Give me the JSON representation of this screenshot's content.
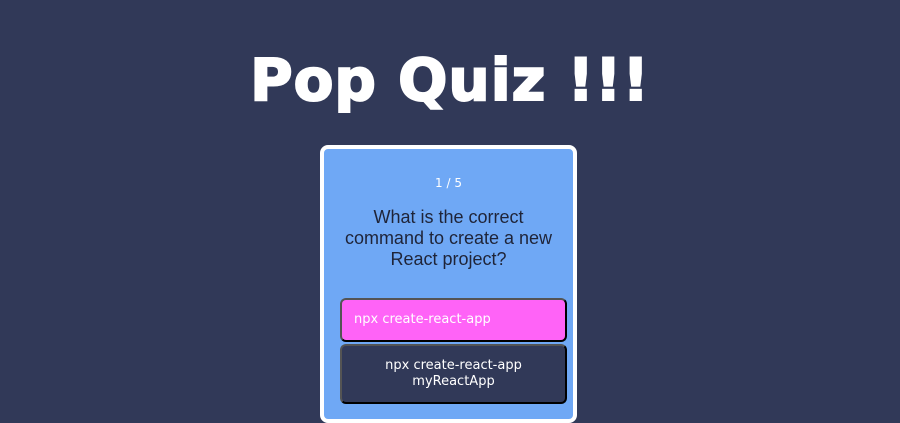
{
  "page": {
    "title": "Pop Quiz !!!"
  },
  "quiz": {
    "counter": "1 / 5",
    "question": "What is the correct command to create a new React project?",
    "options": [
      {
        "label": "npx create-react-app",
        "state": "selected"
      },
      {
        "label": "npx create-react-app myReactApp",
        "state": "default"
      }
    ]
  },
  "colors": {
    "background": "#313958",
    "card": "#6fa8f5",
    "selected_option": "#ff63f7",
    "default_option": "#313958"
  }
}
